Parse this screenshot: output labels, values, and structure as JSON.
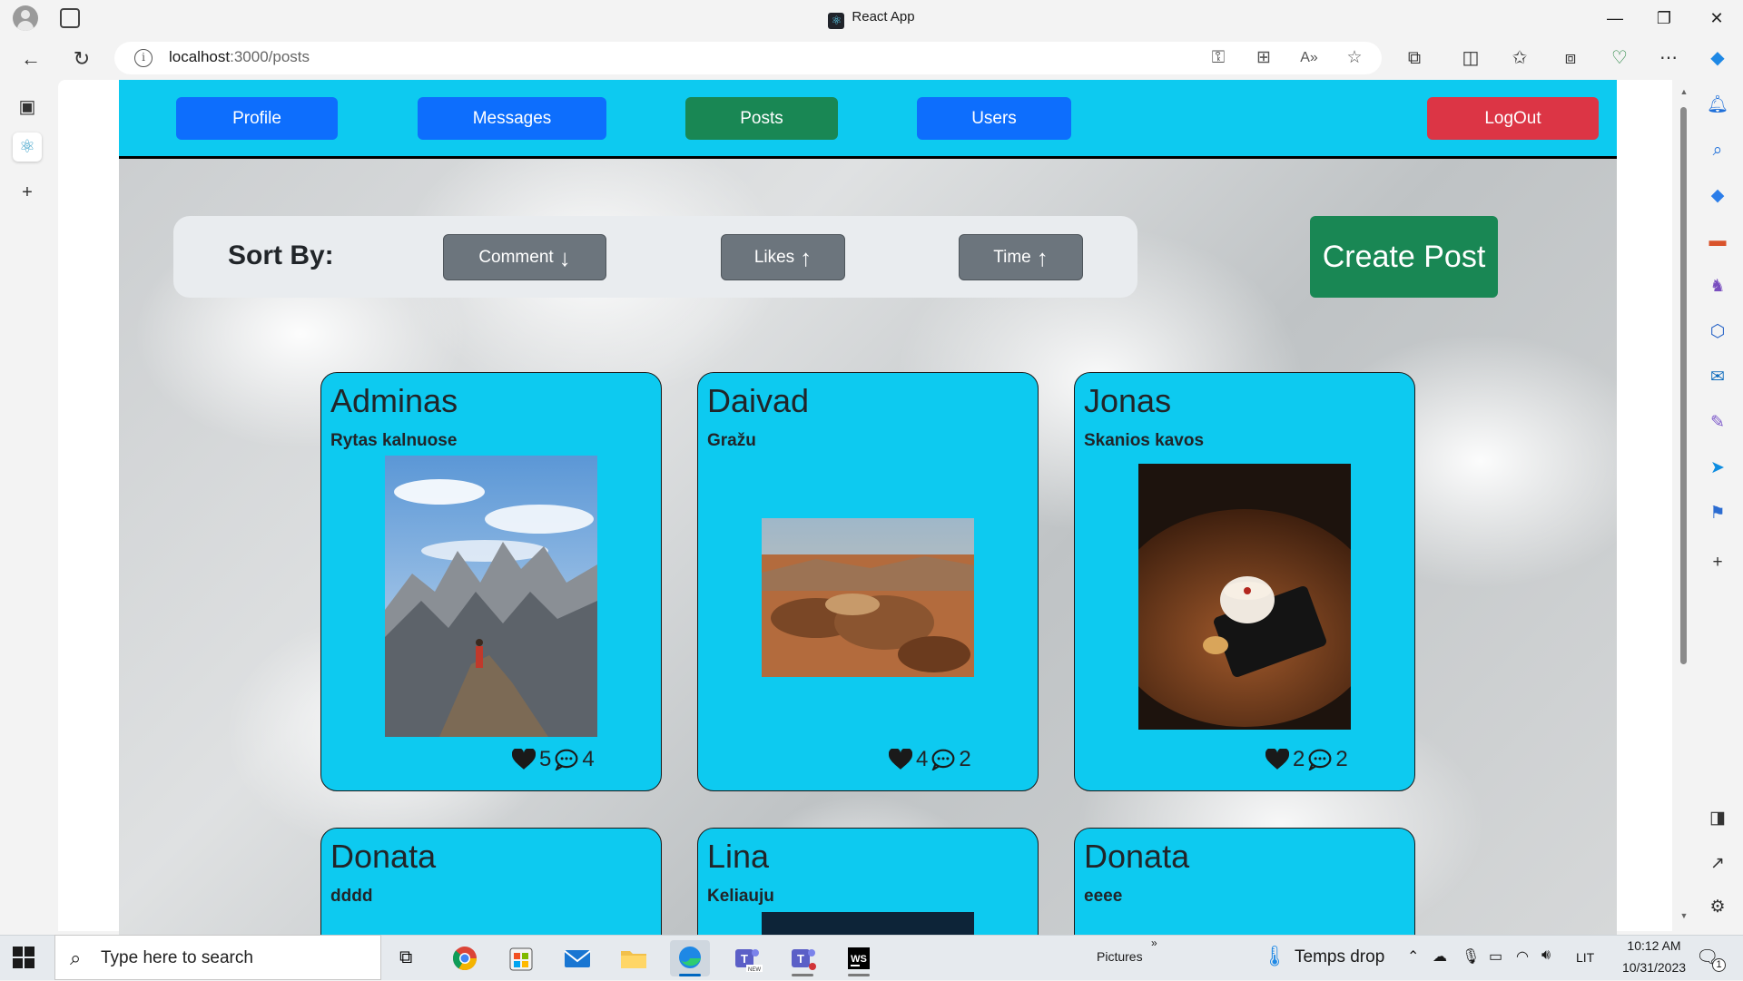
{
  "browser": {
    "window_title": "React App",
    "url_host": "localhost",
    "url_path": ":3000/posts"
  },
  "app": {
    "nav": {
      "profile": "Profile",
      "messages": "Messages",
      "posts": "Posts",
      "users": "Users",
      "logout": "LogOut"
    },
    "sort": {
      "label": "Sort By:",
      "comment": "Comment",
      "likes": "Likes",
      "time": "Time",
      "comment_arrow": "down",
      "likes_arrow": "up",
      "time_arrow": "up"
    },
    "create_post": "Create Post",
    "posts": [
      {
        "author": "Adminas",
        "title": "Rytas kalnuose",
        "likes": "5",
        "comments": "4",
        "image": "mountain-photo"
      },
      {
        "author": "Daivad",
        "title": "Gražu",
        "likes": "4",
        "comments": "2",
        "image": "desert-photo"
      },
      {
        "author": "Jonas",
        "title": "Skanios kavos",
        "likes": "2",
        "comments": "2",
        "image": "coffee-photo"
      },
      {
        "author": "Donata",
        "title": "dddd"
      },
      {
        "author": "Lina",
        "title": "Keliauju"
      },
      {
        "author": "Donata",
        "title": "eeee"
      }
    ]
  },
  "taskbar": {
    "search_placeholder": "Type here to search",
    "pictures_label": "Pictures",
    "weather": "Temps drop",
    "language": "LIT",
    "time": "10:12 AM",
    "date": "10/31/2023",
    "notification_count": "1"
  },
  "colors": {
    "app_nav": "#0dcaf0",
    "primary": "#0d6efd",
    "success": "#198754",
    "danger": "#dc3545",
    "secondary": "#6c757d",
    "card": "#0dcaf0"
  }
}
